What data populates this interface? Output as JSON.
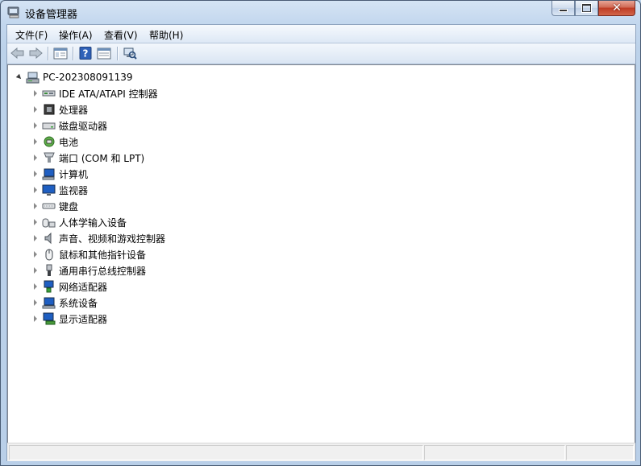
{
  "window": {
    "title": "设备管理器",
    "icon": "device-manager-icon",
    "buttons": {
      "minimize": "minimize-icon",
      "maximize": "maximize-icon",
      "close": "close-icon"
    }
  },
  "menu": [
    {
      "label": "文件(F)"
    },
    {
      "label": "操作(A)"
    },
    {
      "label": "查看(V)"
    },
    {
      "label": "帮助(H)"
    }
  ],
  "toolbar": [
    {
      "icon": "back-arrow-icon"
    },
    {
      "icon": "forward-arrow-icon"
    },
    {
      "icon": "show-hide-console-tree-icon"
    },
    {
      "icon": "help-icon"
    },
    {
      "icon": "properties-icon"
    },
    {
      "icon": "scan-hardware-changes-icon"
    }
  ],
  "tree": {
    "root": {
      "label": "PC-202308091139",
      "icon": "computer-icon",
      "expanded": true
    },
    "items": [
      {
        "label": "IDE ATA/ATAPI 控制器",
        "icon": "ide-controller-icon"
      },
      {
        "label": "处理器",
        "icon": "processor-icon"
      },
      {
        "label": "磁盘驱动器",
        "icon": "disk-drive-icon"
      },
      {
        "label": "电池",
        "icon": "battery-icon"
      },
      {
        "label": "端口 (COM 和 LPT)",
        "icon": "port-icon"
      },
      {
        "label": "计算机",
        "icon": "computer-icon"
      },
      {
        "label": "监视器",
        "icon": "monitor-icon"
      },
      {
        "label": "键盘",
        "icon": "keyboard-icon"
      },
      {
        "label": "人体学输入设备",
        "icon": "hid-icon"
      },
      {
        "label": "声音、视频和游戏控制器",
        "icon": "sound-icon"
      },
      {
        "label": "鼠标和其他指针设备",
        "icon": "mouse-icon"
      },
      {
        "label": "通用串行总线控制器",
        "icon": "usb-icon"
      },
      {
        "label": "网络适配器",
        "icon": "network-adapter-icon"
      },
      {
        "label": "系统设备",
        "icon": "system-devices-icon"
      },
      {
        "label": "显示适配器",
        "icon": "display-adapter-icon"
      }
    ]
  },
  "colors": {
    "titlebar": "#c3d7ee",
    "close_button": "#c7462b",
    "tree_background": "#ffffff"
  }
}
